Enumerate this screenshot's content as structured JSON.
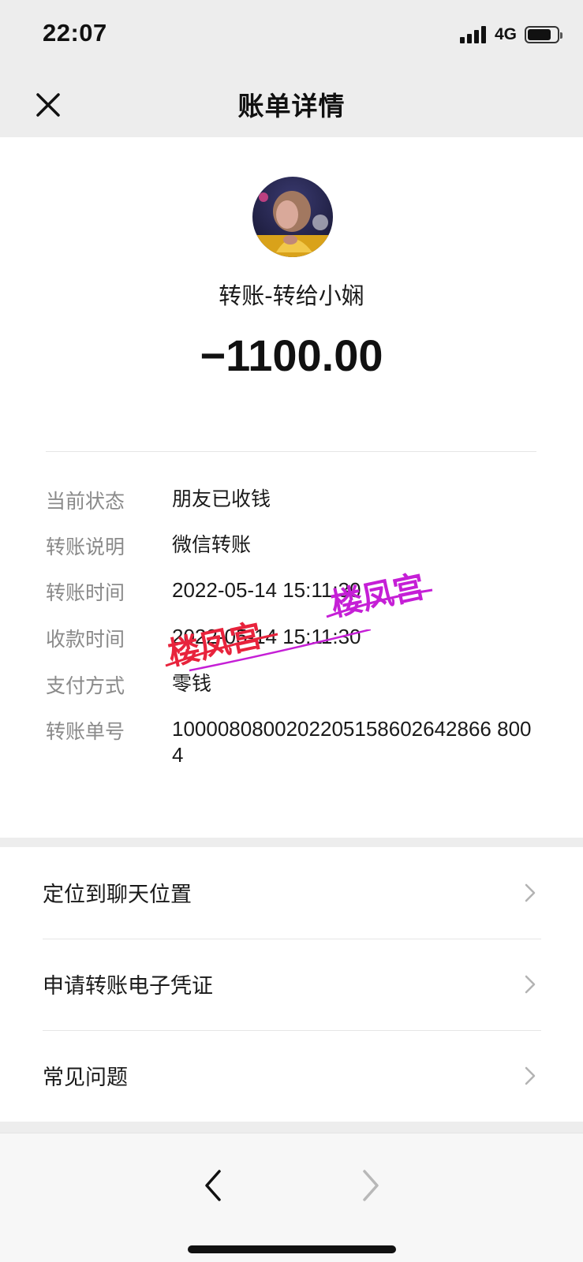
{
  "status_bar": {
    "time": "22:07",
    "network": "4G",
    "icons": [
      "signal-icon",
      "battery-icon"
    ]
  },
  "nav": {
    "title": "账单详情",
    "close_icon": "close-icon"
  },
  "transaction": {
    "payee": "转账-转给小娴",
    "amount": "−1100.00"
  },
  "details": [
    {
      "label": "当前状态",
      "value": "朋友已收钱"
    },
    {
      "label": "转账说明",
      "value": "微信转账"
    },
    {
      "label": "转账时间",
      "value": "2022-05-14 15:11:30"
    },
    {
      "label": "收款时间",
      "value": "2022-05-14 15:11:30"
    },
    {
      "label": "支付方式",
      "value": "零钱"
    },
    {
      "label": "转账单号",
      "value": "1000080800202205158602642866 8004"
    }
  ],
  "watermark": {
    "text": "楼凤宫",
    "colors": [
      "#e8233c",
      "#c51fd6"
    ]
  },
  "menu": [
    {
      "label": "定位到聊天位置",
      "icon": "chevron-right-icon"
    },
    {
      "label": "申请转账电子凭证",
      "icon": "chevron-right-icon"
    },
    {
      "label": "常见问题",
      "icon": "chevron-right-icon"
    }
  ],
  "toolbar": {
    "back_icon": "chevron-left-icon",
    "forward_icon": "chevron-right-icon"
  }
}
